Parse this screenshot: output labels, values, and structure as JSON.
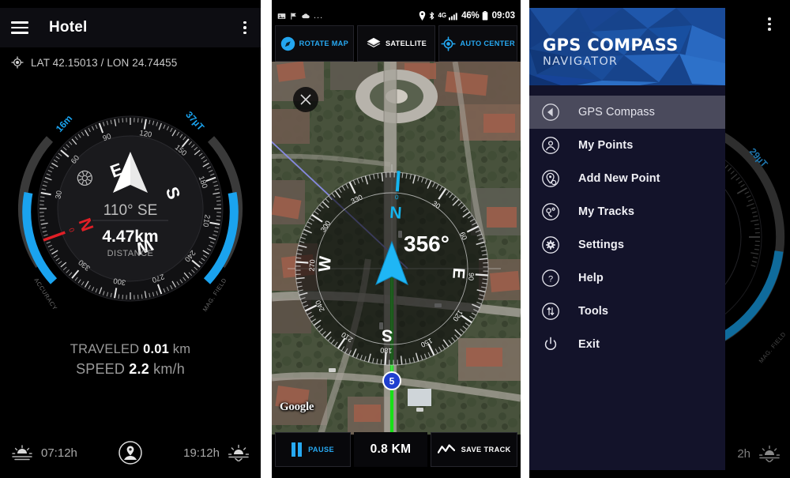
{
  "panel1": {
    "appbar": {
      "title": "Hotel",
      "menu_icon": "hamburger-icon",
      "overflow_icon": "kebab-menu-icon"
    },
    "coords": {
      "icon": "gps-target-icon",
      "text": "LAT 42.15013 / LON 24.74455"
    },
    "compass": {
      "heading_text": "110° SE",
      "distance_value": "4.47km",
      "distance_label": "DISTANCE",
      "accuracy_value": "16m",
      "accuracy_label": "ACCURACY",
      "magfield_value": "37µT",
      "magfield_label": "MAG. FIELD",
      "cardinals": [
        "N",
        "E",
        "S",
        "W"
      ],
      "degree_ticks": [
        "30",
        "60",
        "90",
        "120",
        "150",
        "180",
        "210",
        "240",
        "270",
        "300",
        "330"
      ],
      "needle_north_color": "#e01f26",
      "accent_color": "#1aa3ef",
      "rotation_deg": 110
    },
    "stats": {
      "traveled_label": "TRAVELED",
      "traveled_value": "0.01",
      "traveled_unit": "km",
      "speed_label": "SPEED",
      "speed_value": "2.2",
      "speed_unit": "km/h"
    },
    "bottom": {
      "sunrise_icon": "sunrise-icon",
      "sunrise_time": "07:12h",
      "center_icon": "location-person-icon",
      "sunset_icon": "sunset-icon",
      "sunset_time": "19:12h"
    }
  },
  "panel2": {
    "statusbar": {
      "left_icons": [
        "image-icon",
        "flag-icon",
        "cloud-icon",
        "more-dots-icon"
      ],
      "right_icons": [
        "location-pin-icon",
        "bluetooth-icon",
        "4g-icon",
        "signal-bars-icon"
      ],
      "network": "4G",
      "battery_pct": "46%",
      "battery_icon": "battery-icon",
      "clock": "09:03"
    },
    "buttons": [
      {
        "label": "ROTATE MAP",
        "icon": "compass-icon",
        "name": "rotate-map-button",
        "style": "blue"
      },
      {
        "label": "SATELLITE",
        "icon": "layers-icon",
        "name": "satellite-button",
        "style": "white"
      },
      {
        "label": "AUTO CENTER",
        "icon": "gps-target-icon",
        "name": "auto-center-button",
        "style": "blue"
      }
    ],
    "map": {
      "watermark": "Google",
      "close_icon": "close-x-icon",
      "road_shield": "5",
      "track_color": "#18e018",
      "bearing_line_color": "#8a8ce8"
    },
    "compass": {
      "heading_text": "356°",
      "cardinals": [
        "N",
        "E",
        "S",
        "W"
      ],
      "degree_ticks": [
        "0",
        "30",
        "60",
        "90",
        "120",
        "150",
        "180",
        "210",
        "240",
        "270",
        "300",
        "330"
      ],
      "north_color": "#14b5f0",
      "arrow_color": "#1fb6f5",
      "rotation_deg": -4
    },
    "bottombar": [
      {
        "label": "PAUSE",
        "icon": "pause-icon",
        "name": "pause-button"
      },
      {
        "label": "0.8 KM",
        "icon": "",
        "name": "distance-readout"
      },
      {
        "label": "SAVE TRACK",
        "icon": "track-line-icon",
        "name": "save-track-button"
      }
    ]
  },
  "panel3": {
    "overflow_icon": "kebab-menu-icon",
    "header": {
      "title": "GPS COMPASS",
      "subtitle": "NAVIGATOR",
      "bg_color": "#17448c"
    },
    "menu": [
      {
        "label": "GPS Compass",
        "icon": "compass-arrow-icon",
        "name": "drawer-item-gps-compass",
        "active": true
      },
      {
        "label": "My Points",
        "icon": "my-points-icon",
        "name": "drawer-item-my-points",
        "active": false
      },
      {
        "label": "Add New Point",
        "icon": "add-point-icon",
        "name": "drawer-item-add-new-point",
        "active": false
      },
      {
        "label": "My Tracks",
        "icon": "my-tracks-icon",
        "name": "drawer-item-my-tracks",
        "active": false
      },
      {
        "label": "Settings",
        "icon": "gear-icon",
        "name": "drawer-item-settings",
        "active": false
      },
      {
        "label": "Help",
        "icon": "question-mark-icon",
        "name": "drawer-item-help",
        "active": false
      },
      {
        "label": "Tools",
        "icon": "arrows-updown-icon",
        "name": "drawer-item-tools",
        "active": false
      },
      {
        "label": "Exit",
        "icon": "power-icon",
        "name": "drawer-item-exit",
        "active": false
      }
    ],
    "background_compass": {
      "magfield_value": "29µT",
      "magfield_label": "MAG. FIELD"
    },
    "bottom": {
      "sunset_time": "2h",
      "sunset_icon": "sunset-icon"
    }
  }
}
